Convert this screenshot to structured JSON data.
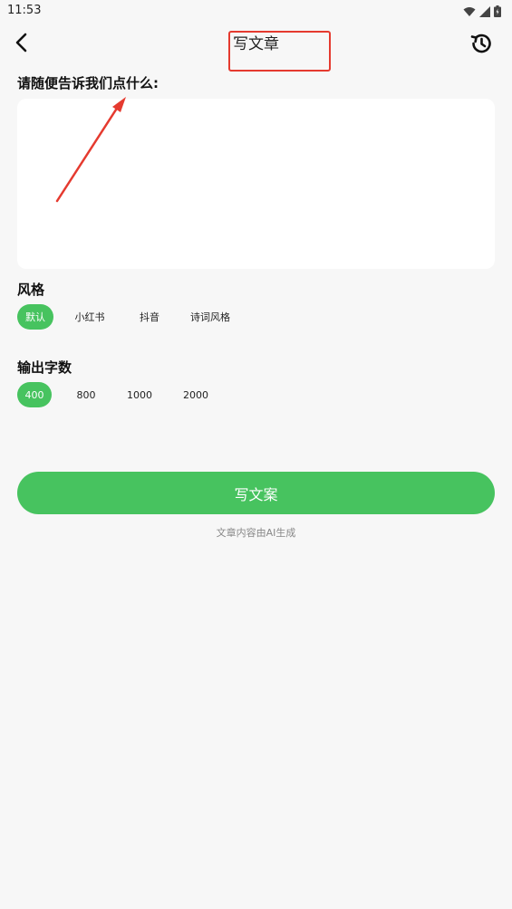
{
  "status_bar": {
    "time": "11:53"
  },
  "header": {
    "title": "写文章"
  },
  "prompt": {
    "label": "请随便告诉我们点什么:",
    "value": "",
    "placeholder": ""
  },
  "style_section": {
    "label": "风格",
    "options": [
      "默认",
      "小红书",
      "抖音",
      "诗词风格"
    ],
    "selected": "默认"
  },
  "length_section": {
    "label": "输出字数",
    "options": [
      "400",
      "800",
      "1000",
      "2000"
    ],
    "selected": "400"
  },
  "action": {
    "button_label": "写文案",
    "footnote": "文章内容由AI生成"
  },
  "colors": {
    "accent": "#47c35f",
    "annotation": "#e53a2f",
    "background": "#f7f7f7"
  },
  "icons": {
    "back": "chevron-left-icon",
    "history": "history-icon",
    "wifi": "wifi-icon",
    "signal": "signal-icon",
    "battery": "battery-icon"
  }
}
